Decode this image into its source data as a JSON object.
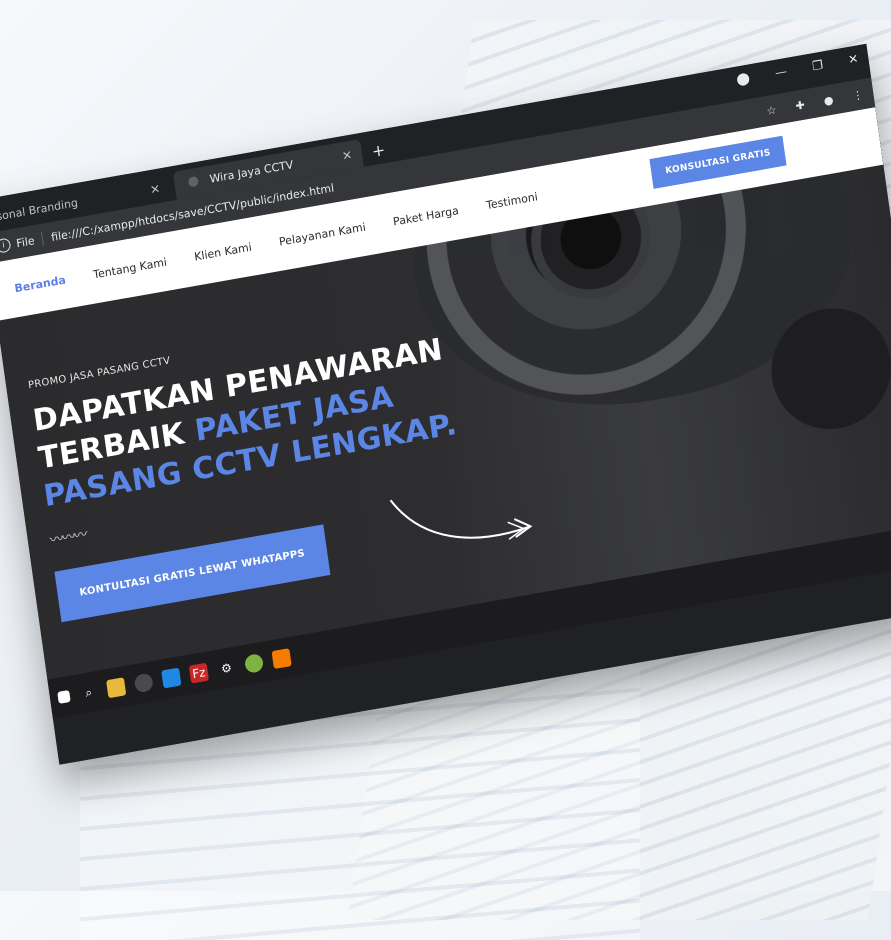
{
  "browser": {
    "tabs": [
      {
        "label": "sonal Branding",
        "active": false
      },
      {
        "label": "Wira Jaya CCTV",
        "active": true
      }
    ],
    "new_tab_label": "+",
    "address_prefix": "File",
    "url": "file:///C:/xampp/htdocs/save/CCTV/public/index.html"
  },
  "nav": {
    "items": [
      {
        "label": "Beranda",
        "active": true
      },
      {
        "label": "Tentang Kami",
        "active": false
      },
      {
        "label": "Klien Kami",
        "active": false
      },
      {
        "label": "Pelayanan Kami",
        "active": false
      },
      {
        "label": "Paket Harga",
        "active": false
      },
      {
        "label": "Testimoni",
        "active": false
      }
    ],
    "cta_label": "KONSULTASI GRATIS"
  },
  "hero": {
    "eyebrow": "PROMO JASA PASANG CCTV",
    "headline_part1": "DAPATKAN PENAWARAN TERBAIK ",
    "headline_accent": "PAKET JASA PASANG CCTV LENGKAP.",
    "button_label": "KONTULTASI GRATIS LEWAT WHATAPPS"
  },
  "colors": {
    "accent": "#5b86e5",
    "dark_bg": "#2b2b2d",
    "chrome_dark": "#202124"
  },
  "icons": [
    "info-icon",
    "close-icon",
    "star-icon",
    "extensions-icon",
    "avatar",
    "menu-icon",
    "start-icon",
    "search-icon",
    "folder-icon",
    "chrome-icon",
    "vscode-icon",
    "filezilla-icon",
    "settings-icon"
  ]
}
